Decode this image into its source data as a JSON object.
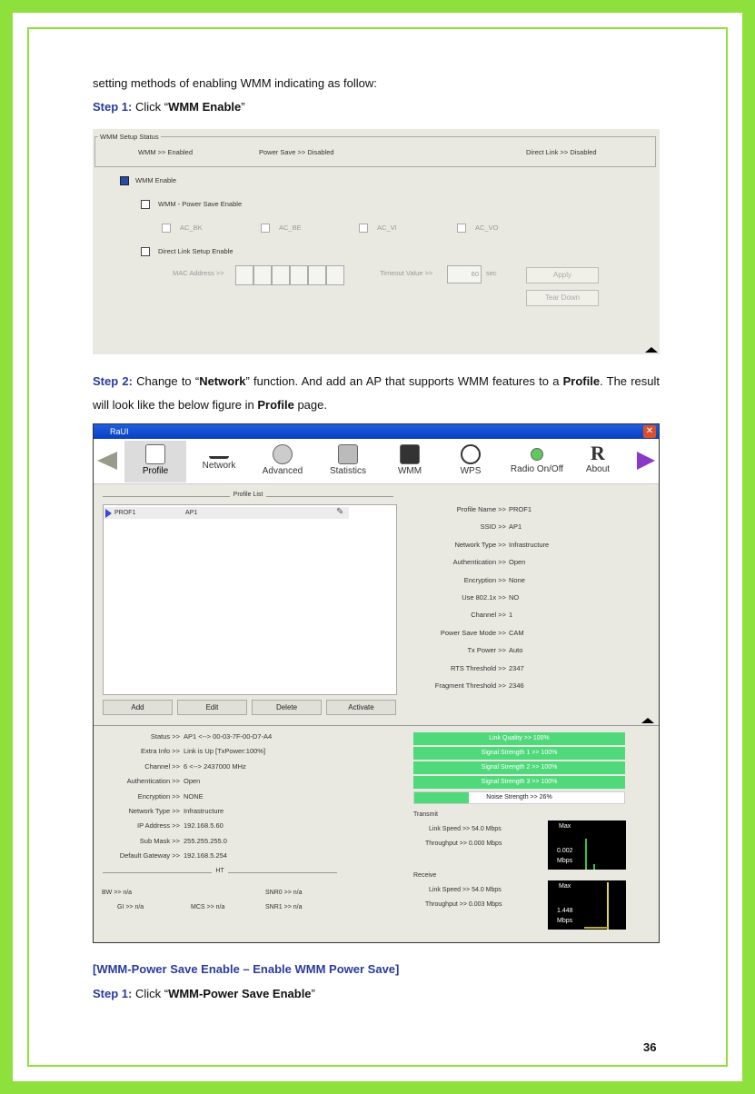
{
  "intro": "setting methods of enabling WMM indicating as follow:",
  "step1a": {
    "label": "Step 1:",
    "pre": " Click “",
    "bold": "WMM Enable",
    "post": "”"
  },
  "wmm": {
    "group": "WMM Setup Status",
    "wmm_status": "WMM >> Enabled",
    "ps_status": "Power Save >> Disabled",
    "dl_status": "Direct Link >> Disabled",
    "enable": "WMM Enable",
    "ps_enable": "WMM - Power Save Enable",
    "ac": [
      "AC_BK",
      "AC_BE",
      "AC_VI",
      "AC_VO"
    ],
    "dls_enable": "Direct Link Setup Enable",
    "mac": "MAC Address >>",
    "timeout": "Timeout Value >>",
    "timeout_val": "60",
    "sec": "sec",
    "apply": "Apply",
    "teardown": "Tear Down"
  },
  "step2": {
    "label": "Step 2:",
    "t1": " Change to “",
    "b1": "Network",
    "t2": "” function. And add an AP that supports WMM features to a ",
    "b2": "Profile",
    "t3": ". The result will look like the below figure in ",
    "b3": "Profile",
    "t4": " page."
  },
  "raui": {
    "title": "RaUI",
    "tabs": [
      "Profile",
      "Network",
      "Advanced",
      "Statistics",
      "WMM",
      "WPS",
      "Radio On/Off",
      "About"
    ],
    "list_title": "Profile List",
    "row": {
      "name": "PROF1",
      "ssid": "AP1"
    },
    "buttons": [
      "Add",
      "Edit",
      "Delete",
      "Activate"
    ],
    "details": [
      {
        "k": "Profile Name >>",
        "v": "PROF1"
      },
      {
        "k": "SSID >>",
        "v": "AP1"
      },
      {
        "k": "Network Type >>",
        "v": "Infrastructure"
      },
      {
        "k": "Authentication >>",
        "v": "Open"
      },
      {
        "k": "Encryption >>",
        "v": "None"
      },
      {
        "k": "Use 802.1x >>",
        "v": "NO"
      },
      {
        "k": "Channel >>",
        "v": "1"
      },
      {
        "k": "Power Save Mode >>",
        "v": "CAM"
      },
      {
        "k": "Tx Power >>",
        "v": "Auto"
      },
      {
        "k": "RTS Threshold >>",
        "v": "2347"
      },
      {
        "k": "Fragment Threshold >>",
        "v": "2346"
      }
    ],
    "status": [
      {
        "k": "Status >>",
        "v": "AP1 <--> 00-03-7F-00-D7-A4"
      },
      {
        "k": "Extra Info >>",
        "v": "Link is Up [TxPower:100%]"
      },
      {
        "k": "Channel >>",
        "v": "6 <--> 2437000 MHz"
      },
      {
        "k": "Authentication >>",
        "v": "Open"
      },
      {
        "k": "Encryption >>",
        "v": "NONE"
      },
      {
        "k": "Network Type >>",
        "v": "Infrastructure"
      },
      {
        "k": "IP Address >>",
        "v": "192.168.5.60"
      },
      {
        "k": "Sub Mask >>",
        "v": "255.255.255.0"
      },
      {
        "k": "Default Gateway >>",
        "v": "192.168.5.254"
      }
    ],
    "ht": "HT",
    "bw": "BW >> n/a",
    "gi": "GI >> n/a",
    "mcs": "MCS >> n/a",
    "snr0": "SNR0 >> n/a",
    "snr1": "SNR1 >> n/a",
    "bars": [
      "Link Quality >> 100%",
      "Signal Strength 1 >> 100%",
      "Signal Strength 2 >> 100%",
      "Signal Strength 3 >> 100%",
      "Noise Strength >> 26%"
    ],
    "noise_level": 0.26,
    "transmit": "Transmit",
    "receive": "Receive",
    "tx_speed": "Link Speed >> 54.0 Mbps",
    "tx_tp": "Throughput >> 0.000 Mbps",
    "rx_speed": "Link Speed >> 54.0 Mbps",
    "rx_tp": "Throughput >> 0.003 Mbps",
    "max": "Max",
    "tx_val": "0.002",
    "rx_val": "1.448",
    "mbps": "Mbps"
  },
  "heading": "[WMM-Power Save Enable – Enable WMM Power Save]",
  "step1b": {
    "label": "Step 1:",
    "pre": " Click “",
    "bold": "WMM-Power Save Enable",
    "post": "”"
  },
  "page_number": "36"
}
